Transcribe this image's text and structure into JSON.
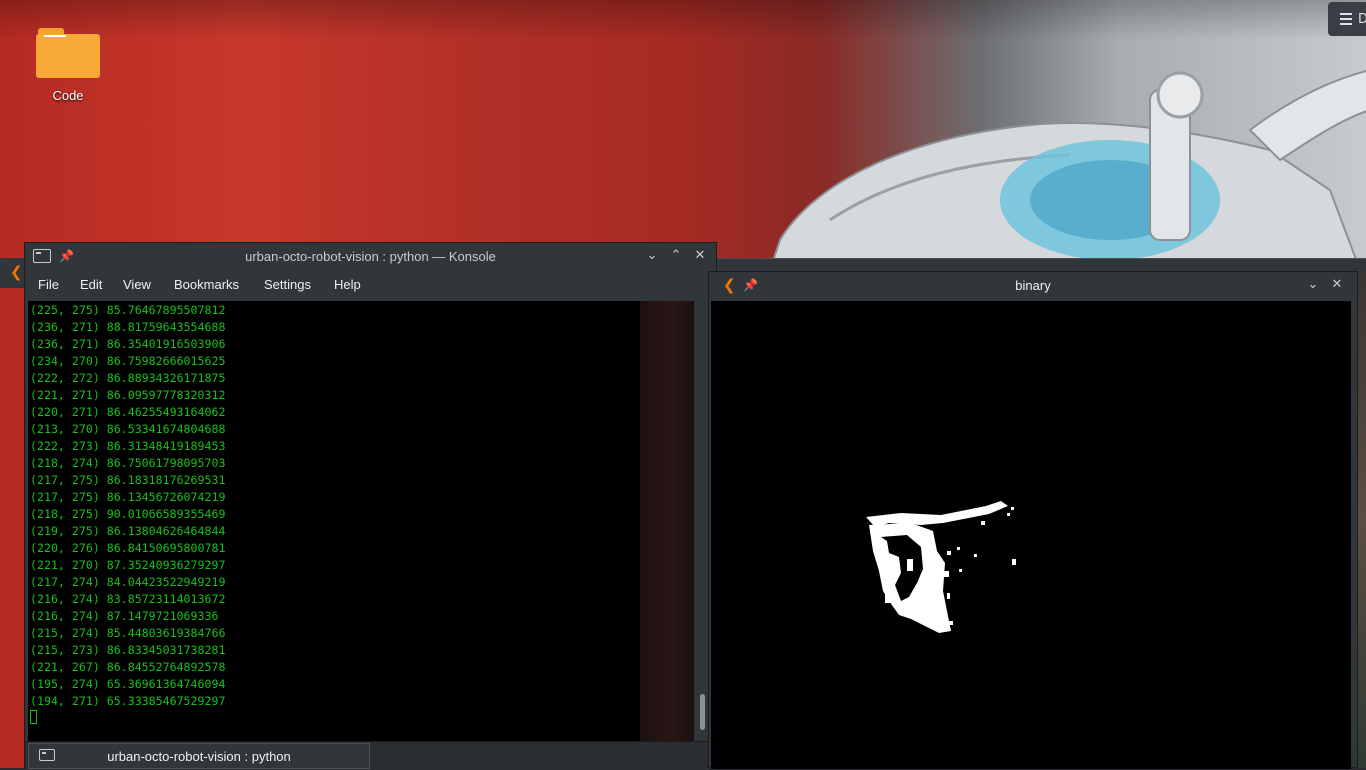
{
  "desktop": {
    "icons": [
      {
        "label": "Code",
        "icon": "folder-icon"
      }
    ],
    "panel_button": {
      "icon": "hamburger-icon",
      "text": "D"
    }
  },
  "konsole": {
    "title": "urban-octo-robot-vision : python — Konsole",
    "menu": [
      "File",
      "Edit",
      "View",
      "Bookmarks",
      "Settings",
      "Help"
    ],
    "terminal_lines": [
      "(225, 275) 85.76467895507812",
      "(236, 271) 88.81759643554688",
      "(236, 271) 86.35401916503906",
      "(234, 270) 86.75982666015625",
      "(222, 272) 86.88934326171875",
      "(221, 271) 86.09597778320312",
      "(220, 271) 86.46255493164062",
      "(213, 270) 86.53341674804688",
      "(222, 273) 86.31348419189453",
      "(218, 274) 86.75061798095703",
      "(217, 275) 86.18318176269531",
      "(217, 275) 86.13456726074219",
      "(218, 275) 90.01066589355469",
      "(219, 275) 86.13804626464844",
      "(220, 276) 86.84150695800781",
      "(221, 270) 87.35240936279297",
      "(217, 274) 84.04423522949219",
      "(216, 274) 83.85723114013672",
      "(216, 274) 87.1479721069336",
      "(215, 274) 85.44803619384766",
      "(215, 273) 86.83345031738281",
      "(221, 267) 86.84552764892578",
      "(195, 274) 65.36961364746094",
      "(194, 271) 65.33385467529297"
    ],
    "tab_label": "urban-octo-robot-vision : python",
    "text_color": "#18c018",
    "scroll_position": 0.95
  },
  "binary_window": {
    "title": "binary"
  },
  "colors": {
    "window_bg": "#31363b",
    "kde_accent": "#f67400",
    "wallpaper_red": "#c8382c"
  }
}
